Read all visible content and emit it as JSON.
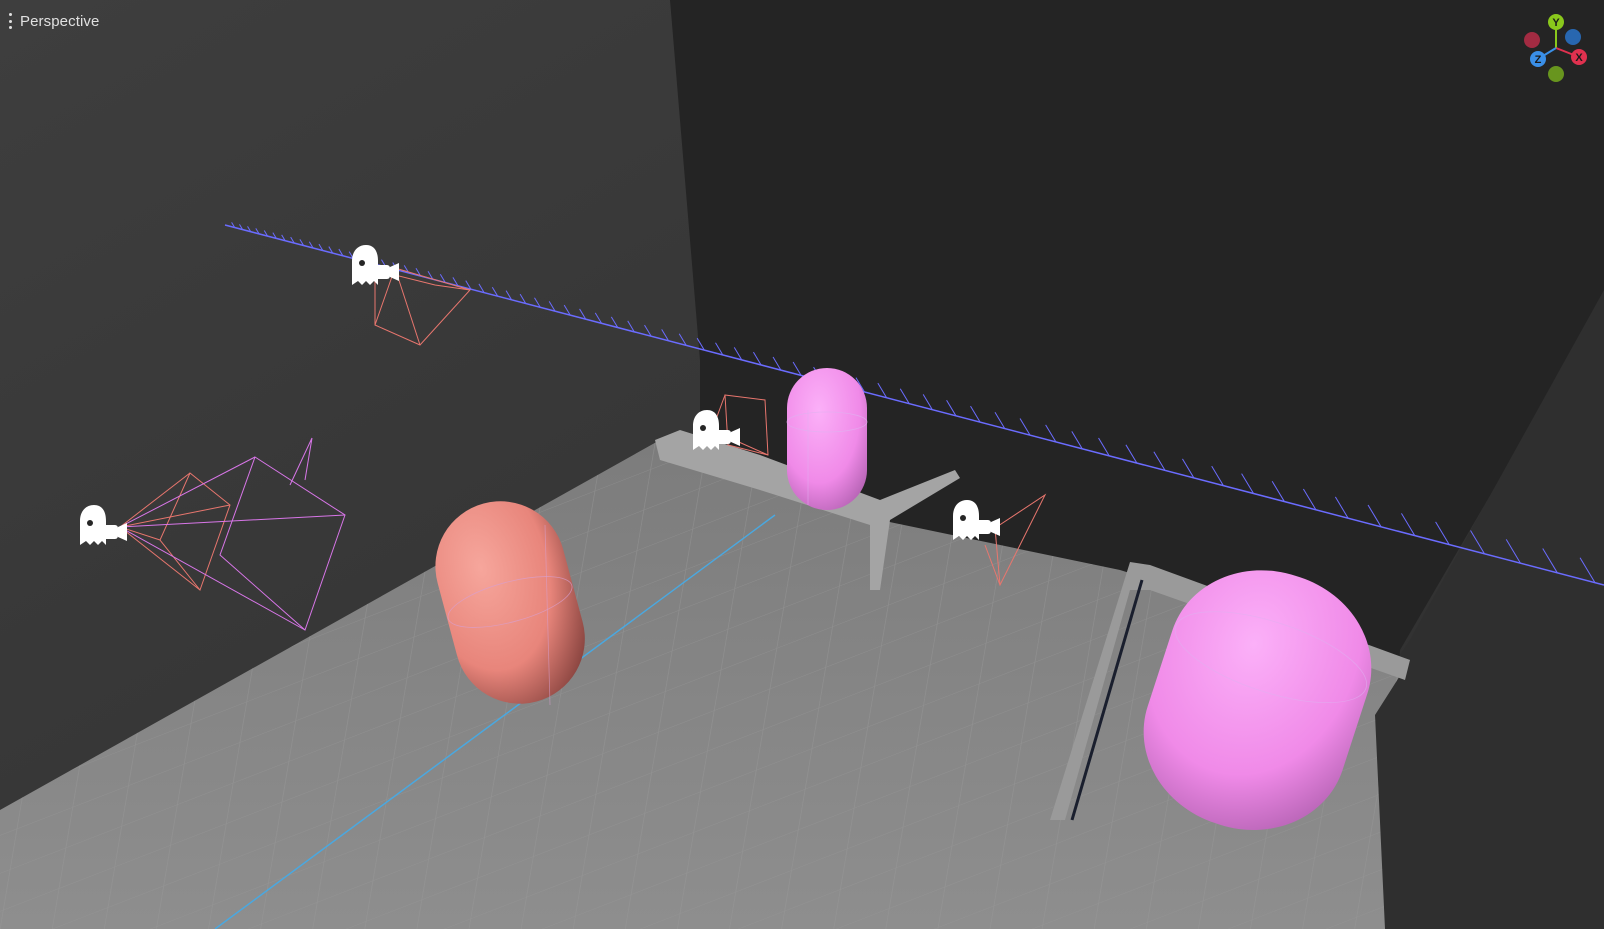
{
  "viewport": {
    "view_label": "Perspective",
    "menu_icon": "kebab-menu-icon"
  },
  "gizmo": {
    "y_label": "Y",
    "x_label": "X",
    "z_label": "Z",
    "colors": {
      "x": "#e0314f",
      "y": "#8ac81c",
      "z": "#3a8fe8",
      "neg_x": "#a32b42",
      "neg_y": "#68951e",
      "neg_z": "#2867b0"
    }
  },
  "scene": {
    "objects": [
      {
        "name": "camera-gizmo-top-left",
        "icon": "camera-icon"
      },
      {
        "name": "camera-gizmo-left",
        "icon": "camera-icon"
      },
      {
        "name": "camera-gizmo-center",
        "icon": "camera-icon"
      },
      {
        "name": "camera-gizmo-right",
        "icon": "camera-icon"
      },
      {
        "name": "capsule-salmon",
        "color": "#f08a80"
      },
      {
        "name": "capsule-pink-small",
        "color": "#f48cf0"
      },
      {
        "name": "capsule-pink-large",
        "color": "#f48cf0"
      }
    ],
    "colors": {
      "background_left": "#3a3a3a",
      "background_right": "#242424",
      "floor": "#8a8a8a",
      "path_line": "#6b6cff",
      "frustum_salmon": "#e8766e",
      "frustum_pink": "#d876e8",
      "axis_line": "#4aa8e0"
    }
  }
}
